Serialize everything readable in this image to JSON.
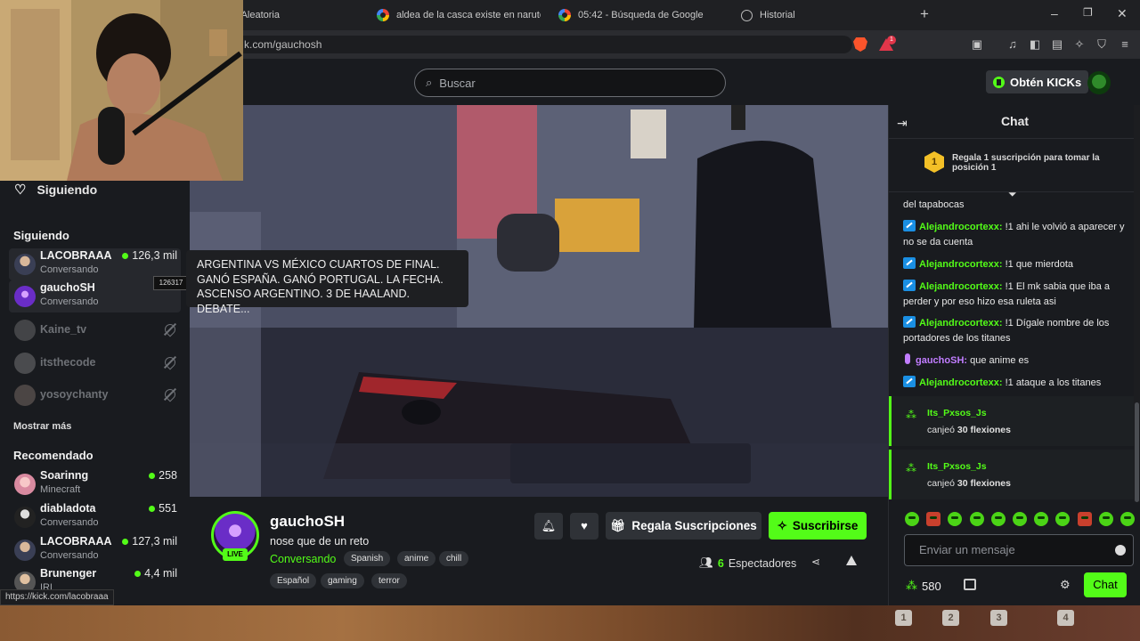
{
  "browser": {
    "tabs": [
      {
        "label": "a Aleatoria"
      },
      {
        "label": "aldea de la casca existe en naruto? - B"
      },
      {
        "label": "05:42 - Búsqueda de Google"
      },
      {
        "label": "Historial"
      }
    ],
    "url": "k.com/gauchosh",
    "status_url": "https://kick.com/lacobraaa",
    "rewards_count": "1"
  },
  "header": {
    "search_placeholder": "Buscar",
    "kicks_label": "Obtén KICKs"
  },
  "sidebar": {
    "following_label": "Siguiendo",
    "following_section": "Siguiendo",
    "following": [
      {
        "name": "LACOBRAAA",
        "category": "Conversando",
        "viewers": "126,3 mil",
        "live": true
      },
      {
        "name": "gauchoSH",
        "category": "Conversando",
        "viewers": "",
        "live": true
      },
      {
        "name": "Kaine_tv",
        "live": false
      },
      {
        "name": "itsthecode",
        "live": false
      },
      {
        "name": "yosoychanty",
        "live": false
      }
    ],
    "tooltip": "126317",
    "show_more": "Mostrar más",
    "recommended_section": "Recomendado",
    "recommended": [
      {
        "name": "Soarinng",
        "category": "Minecraft",
        "viewers": "258"
      },
      {
        "name": "diabladota",
        "category": "Conversando",
        "viewers": "551"
      },
      {
        "name": "LACOBRAAA",
        "category": "Conversando",
        "viewers": "127,3 mil"
      },
      {
        "name": "Brunenger",
        "category": "IRL",
        "viewers": "4,4 mil"
      }
    ]
  },
  "stream_title_popup": "ARGENTINA VS MÉXICO CUARTOS DE FINAL. GANÓ ESPAÑA. GANÓ PORTUGAL. LA FECHA. ASCENSO ARGENTINO. 3 DE HAALAND. DEBATE...",
  "stream": {
    "live_badge": "LIVE",
    "streamer": "gauchoSH",
    "title": "nose que de un reto",
    "category": "Conversando",
    "tags_row1": [
      "Spanish",
      "anime",
      "chill"
    ],
    "tags_row2": [
      "Español",
      "gaming",
      "terror"
    ],
    "gift_label": "Regala Suscripciones",
    "subscribe_label": "Suscribirse",
    "viewers_count": "6",
    "viewers_label": "Espectadores"
  },
  "chat": {
    "title": "Chat",
    "pinned": "Regala 1 suscripción para tomar la posición 1",
    "pinned_rank": "1",
    "messages": [
      {
        "user": "",
        "text": "del tapabocas"
      },
      {
        "user": "Alejandrocortexx:",
        "text": " !1 ahi le volvió a aparecer y no se da cuenta"
      },
      {
        "user": "Alejandrocortexx:",
        "text": " !1 que mierdota"
      },
      {
        "user": "Alejandrocortexx:",
        "text": " !1 El mk sabia que iba a perder y por eso hizo esa ruleta asi"
      },
      {
        "user": "Alejandrocortexx:",
        "text": " !1 Dígale nombre de los portadores de los titanes"
      },
      {
        "user": "gauchoSH:",
        "text": " que anime es"
      },
      {
        "user": "Alejandrocortexx:",
        "text": " !1 ataque a los titanes"
      }
    ],
    "events": [
      {
        "user": "Its_Pxsos_Js",
        "action": "canjeó",
        "reward": "30 flexiones"
      },
      {
        "user": "Its_Pxsos_Js",
        "action": "canjeó",
        "reward": "30 flexiones"
      }
    ],
    "input_placeholder": "Enviar un mensaje",
    "points": "580",
    "send_label": "Chat"
  },
  "keyboard_keys": [
    "1",
    "2",
    "3",
    "4"
  ],
  "colors": {
    "accent": "#53fc18",
    "background": "#191b1f"
  }
}
